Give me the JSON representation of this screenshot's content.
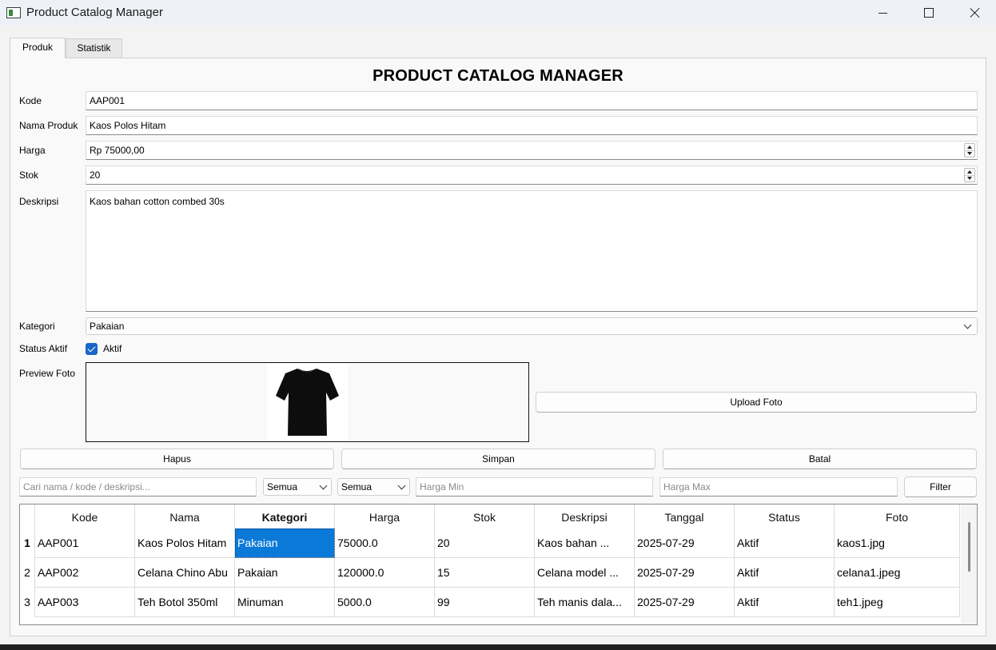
{
  "window": {
    "title": "Product Catalog Manager"
  },
  "tabs": [
    {
      "label": "Produk",
      "active": true
    },
    {
      "label": "Statistik",
      "active": false
    }
  ],
  "heading": "PRODUCT CATALOG MANAGER",
  "form": {
    "kode": {
      "label": "Kode",
      "value": "AAP001"
    },
    "nama": {
      "label": "Nama Produk",
      "value": "Kaos Polos Hitam"
    },
    "harga": {
      "label": "Harga",
      "value": "Rp 75000,00"
    },
    "stok": {
      "label": "Stok",
      "value": "20"
    },
    "deskripsi": {
      "label": "Deskripsi",
      "value": "Kaos bahan cotton combed 30s"
    },
    "kategori": {
      "label": "Kategori",
      "value": "Pakaian"
    },
    "status": {
      "label": "Status Aktif",
      "checkbox_label": "Aktif",
      "checked": true
    },
    "preview": {
      "label": "Preview Foto"
    }
  },
  "buttons": {
    "upload": "Upload Foto",
    "hapus": "Hapus",
    "simpan": "Simpan",
    "batal": "Batal",
    "filter": "Filter"
  },
  "filters": {
    "search_placeholder": "Cari nama / kode / deskripsi...",
    "kategori_value": "Semua",
    "status_value": "Semua",
    "harga_min_placeholder": "Harga Min",
    "harga_max_placeholder": "Harga Max"
  },
  "table": {
    "columns": [
      "Kode",
      "Nama",
      "Kategori",
      "Harga",
      "Stok",
      "Deskripsi",
      "Tanggal",
      "Status",
      "Foto"
    ],
    "rows": [
      {
        "num": "1",
        "cells": [
          "AAP001",
          "Kaos Polos Hitam",
          "Pakaian",
          "75000.0",
          "20",
          "Kaos bahan ...",
          "2025-07-29",
          "Aktif",
          "kaos1.jpg"
        ]
      },
      {
        "num": "2",
        "cells": [
          "AAP002",
          "Celana Chino Abu",
          "Pakaian",
          "120000.0",
          "15",
          "Celana model ...",
          "2025-07-29",
          "Aktif",
          "celana1.jpeg"
        ]
      },
      {
        "num": "3",
        "cells": [
          "AAP003",
          "Teh Botol 350ml",
          "Minuman",
          "5000.0",
          "99",
          "Teh manis dala...",
          "2025-07-29",
          "Aktif",
          "teh1.jpeg"
        ]
      }
    ],
    "selected": {
      "row": 0,
      "col": 2
    }
  },
  "colors": {
    "accent": "#0a79d8",
    "checkbox": "#1a66c7"
  }
}
